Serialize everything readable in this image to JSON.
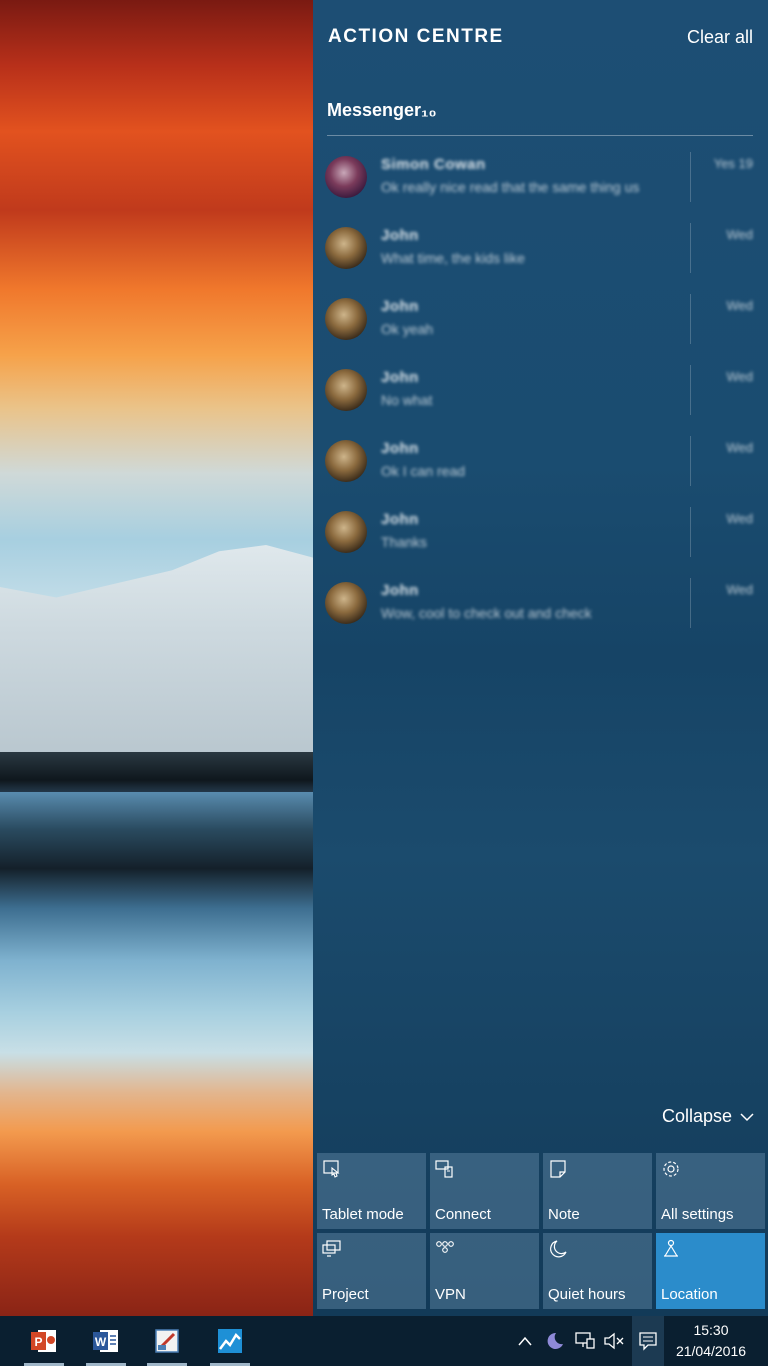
{
  "action_centre": {
    "title": "ACTION CENTRE",
    "clear_all": "Clear all",
    "group": {
      "title": "Messenger₁₀"
    },
    "notifications": [
      {
        "name": "Simon Cowan",
        "message": "Ok really nice read that the same thing us",
        "time": "Yes 19"
      },
      {
        "name": "John",
        "message": "What time, the kids like",
        "time": "Wed"
      },
      {
        "name": "John",
        "message": "Ok yeah",
        "time": "Wed"
      },
      {
        "name": "John",
        "message": "No what",
        "time": "Wed"
      },
      {
        "name": "John",
        "message": "Ok I can read",
        "time": "Wed"
      },
      {
        "name": "John",
        "message": "Thanks",
        "time": "Wed"
      },
      {
        "name": "John",
        "message": "Wow, cool to check out and check",
        "time": "Wed"
      }
    ],
    "collapse_label": "Collapse",
    "quick_actions": [
      {
        "label": "Tablet mode",
        "icon": "tablet-mode-icon",
        "active": false
      },
      {
        "label": "Connect",
        "icon": "connect-icon",
        "active": false
      },
      {
        "label": "Note",
        "icon": "note-icon",
        "active": false
      },
      {
        "label": "All settings",
        "icon": "gear-icon",
        "active": false
      },
      {
        "label": "Project",
        "icon": "project-icon",
        "active": false
      },
      {
        "label": "VPN",
        "icon": "vpn-icon",
        "active": false
      },
      {
        "label": "Quiet hours",
        "icon": "moon-icon",
        "active": false
      },
      {
        "label": "Location",
        "icon": "location-icon",
        "active": true
      }
    ]
  },
  "taskbar": {
    "apps": [
      {
        "name": "PowerPoint",
        "icon": "powerpoint-icon",
        "color": "#d24726"
      },
      {
        "name": "Word",
        "icon": "word-icon",
        "color": "#2b579a"
      },
      {
        "name": "Paint",
        "icon": "paint-icon",
        "color": "#4a7fb5"
      },
      {
        "name": "Stock tracker",
        "icon": "chart-app-icon",
        "color": "#1e90d6"
      }
    ],
    "clock": {
      "time": "15:30",
      "date": "21/04/2016"
    }
  },
  "colors": {
    "accent": "#2b8ccb",
    "panel": "#1a4c70",
    "taskbar": "#0a1f30"
  }
}
